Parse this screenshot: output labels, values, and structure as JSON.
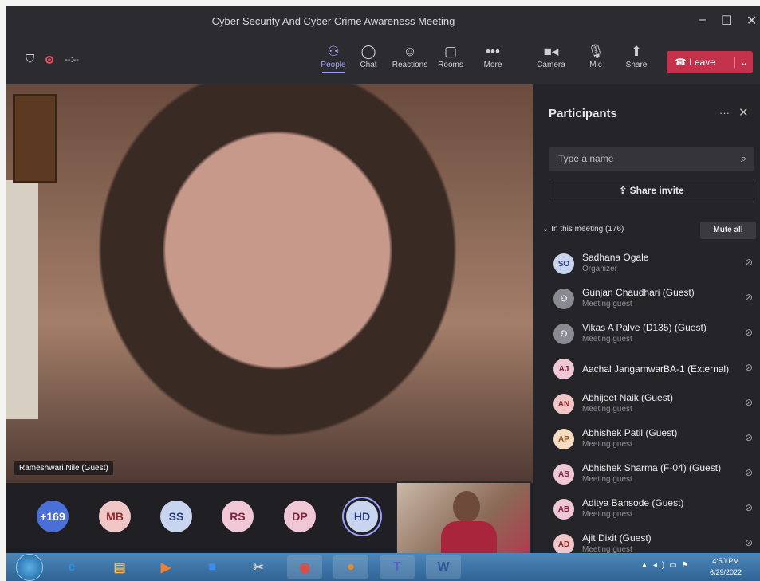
{
  "window": {
    "title": "Cyber Security And Cyber Crime Awareness Meeting",
    "minimize": "–",
    "maximize": "☐",
    "close": "✕"
  },
  "toolbar": {
    "timer": "--:--",
    "items": [
      {
        "label": "People",
        "icon": "people-icon",
        "glyph": "⚇"
      },
      {
        "label": "Chat",
        "icon": "chat-icon",
        "glyph": "◯"
      },
      {
        "label": "Reactions",
        "icon": "reactions-icon",
        "glyph": "☺"
      },
      {
        "label": "Rooms",
        "icon": "rooms-icon",
        "glyph": "▢"
      },
      {
        "label": "More",
        "icon": "more-icon",
        "glyph": "•••"
      },
      {
        "label": "Camera",
        "icon": "camera-icon",
        "glyph": "■◂"
      },
      {
        "label": "Mic",
        "icon": "mic-off-icon",
        "glyph": "🎙"
      },
      {
        "label": "Share",
        "icon": "share-icon",
        "glyph": "⬆"
      }
    ],
    "leave": "Leave",
    "leave_color": "#c4314b",
    "active_color": "#9ea2ff"
  },
  "video": {
    "speaker_name": "Rameshwari Nile (Guest)"
  },
  "avatars": [
    {
      "initials": "+169",
      "bg": "#4a6fd6",
      "fg": "#ffffff"
    },
    {
      "initials": "MB",
      "bg": "#f1c6c6",
      "fg": "#8a2a2a"
    },
    {
      "initials": "SS",
      "bg": "#c9d4ef",
      "fg": "#2a3f7a"
    },
    {
      "initials": "RS",
      "bg": "#f0c7d4",
      "fg": "#7a2540"
    },
    {
      "initials": "DP",
      "bg": "#f0c7d4",
      "fg": "#7a2540"
    },
    {
      "initials": "HD",
      "bg": "#c9d4ef",
      "fg": "#2a3f7a"
    }
  ],
  "participants": {
    "title": "Participants",
    "more": "···",
    "close": "✕",
    "search_placeholder": "Type a name",
    "share_invite": "Share invite",
    "section": "In this meeting (176)",
    "mute_all": "Mute all",
    "list": [
      {
        "initials": "SO",
        "name": "Sadhana Ogale",
        "role": "Organizer",
        "bg": "#c9d4ef",
        "fg": "#2a3f7a"
      },
      {
        "initials": "",
        "name": "Gunjan Chaudhari (Guest)",
        "role": "Meeting guest",
        "bg": "#8a8a92",
        "fg": "#ffffff"
      },
      {
        "initials": "",
        "name": "Vikas A Palve (D135) (Guest)",
        "role": "Meeting guest",
        "bg": "#8a8a92",
        "fg": "#ffffff"
      },
      {
        "initials": "AJ",
        "name": "Aachal JangamwarBA-1 (External)",
        "role": "",
        "bg": "#f0c7d4",
        "fg": "#7a2540"
      },
      {
        "initials": "AN",
        "name": "Abhijeet Naik (Guest)",
        "role": "Meeting guest",
        "bg": "#f1c6c6",
        "fg": "#8a2a2a"
      },
      {
        "initials": "AP",
        "name": "Abhishek Patil (Guest)",
        "role": "Meeting guest",
        "bg": "#f6dcc0",
        "fg": "#8a5a20"
      },
      {
        "initials": "AS",
        "name": "Abhishek Sharma (F-04) (Guest)",
        "role": "Meeting guest",
        "bg": "#f0c7d4",
        "fg": "#7a2540"
      },
      {
        "initials": "AB",
        "name": "Aditya Bansode (Guest)",
        "role": "Meeting guest",
        "bg": "#f0c7d4",
        "fg": "#7a2540"
      },
      {
        "initials": "AD",
        "name": "Ajit Dixit (Guest)",
        "role": "Meeting guest",
        "bg": "#f1c6c6",
        "fg": "#8a2a2a"
      }
    ]
  },
  "taskbar": {
    "apps": [
      {
        "name": "internet-explorer-icon",
        "glyph": "e",
        "color": "#2f8fe0"
      },
      {
        "name": "file-explorer-icon",
        "glyph": "▤",
        "color": "#e8c060"
      },
      {
        "name": "media-player-icon",
        "glyph": "▶",
        "color": "#f08030"
      },
      {
        "name": "zoom-icon",
        "glyph": "■",
        "color": "#3a8ef0"
      },
      {
        "name": "snipping-icon",
        "glyph": "✂",
        "color": "#d0d0d0"
      },
      {
        "name": "chrome-icon",
        "glyph": "◉",
        "color": "#e04a3a"
      },
      {
        "name": "firefox-icon",
        "glyph": "●",
        "color": "#f08a20"
      },
      {
        "name": "teams-icon",
        "glyph": "T",
        "color": "#5b5fc7"
      },
      {
        "name": "word-icon",
        "glyph": "W",
        "color": "#2b5797"
      }
    ],
    "time": "4:50 PM",
    "date": "6/29/2022"
  }
}
